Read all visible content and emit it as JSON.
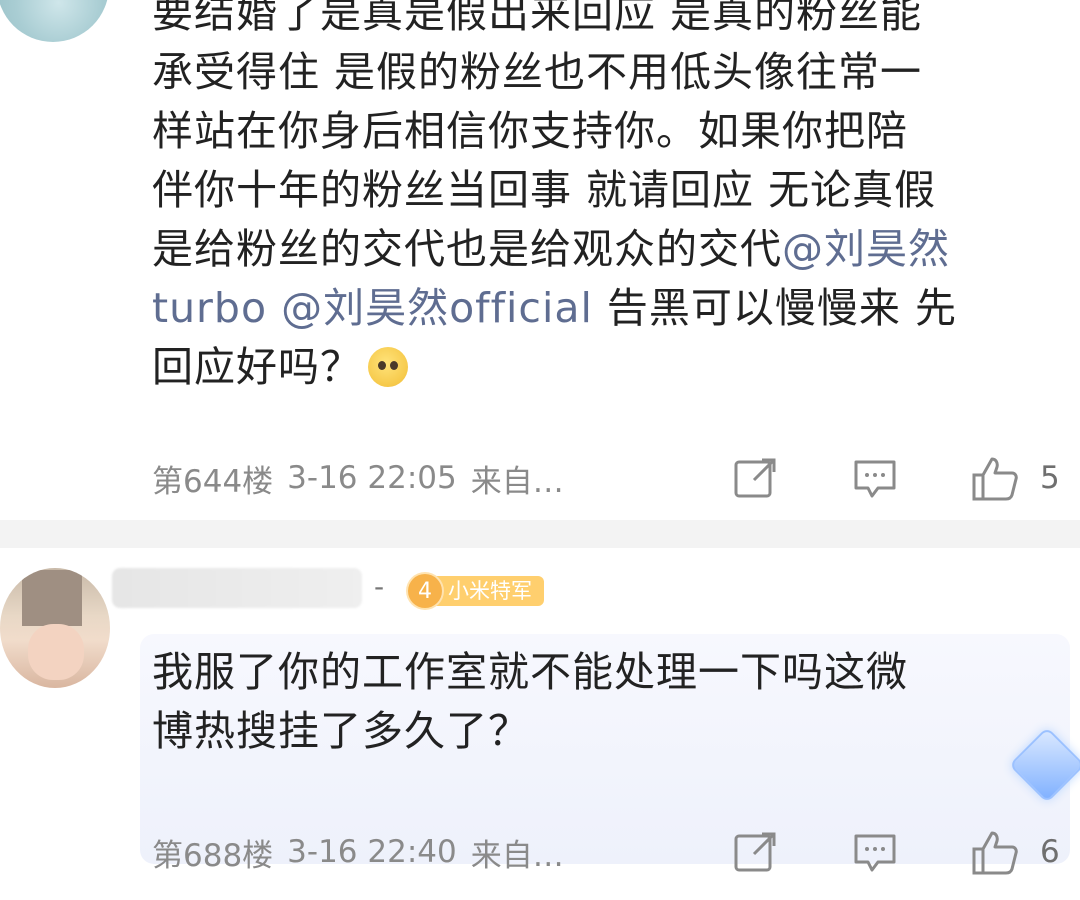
{
  "comments": [
    {
      "body_lines": [
        "要结婚了是真是假出来回应 是真的粉丝能",
        "承受得住 是假的粉丝也不用低头像往常一",
        "样站在你身后相信你支持你。如果你把陪",
        "伴你十年的粉丝当回事 就请回应 无论真假",
        "是给粉丝的交代也是给观众的交代"
      ],
      "mention_1a": "@刘昊然",
      "mention_1b": "turbo",
      "mention_2": "@刘昊然official",
      "tail_line_6": " 告黑可以慢慢来 先",
      "tail_line_7": "回应好吗？",
      "emoji": "pleading-face-emoji",
      "floor": "第644楼",
      "time": "3-16 22:05",
      "source": "来自…",
      "likes": "5"
    },
    {
      "username_hidden": true,
      "separator": "-",
      "badge_level": "4",
      "badge_label": "小米特军",
      "body_lines": [
        "我服了你的工作室就不能处理一下吗这微",
        "博热搜挂了多久了？"
      ],
      "floor": "第688楼",
      "time": "3-16 22:40",
      "source": "来自…",
      "likes": "6"
    }
  ],
  "colors": {
    "mention": "#5f6d91",
    "meta": "#8a8a8a",
    "badge": "#ffcf6e",
    "bubble": "#f2f4fc"
  },
  "icons": [
    "share-icon",
    "comment-icon",
    "like-icon"
  ]
}
